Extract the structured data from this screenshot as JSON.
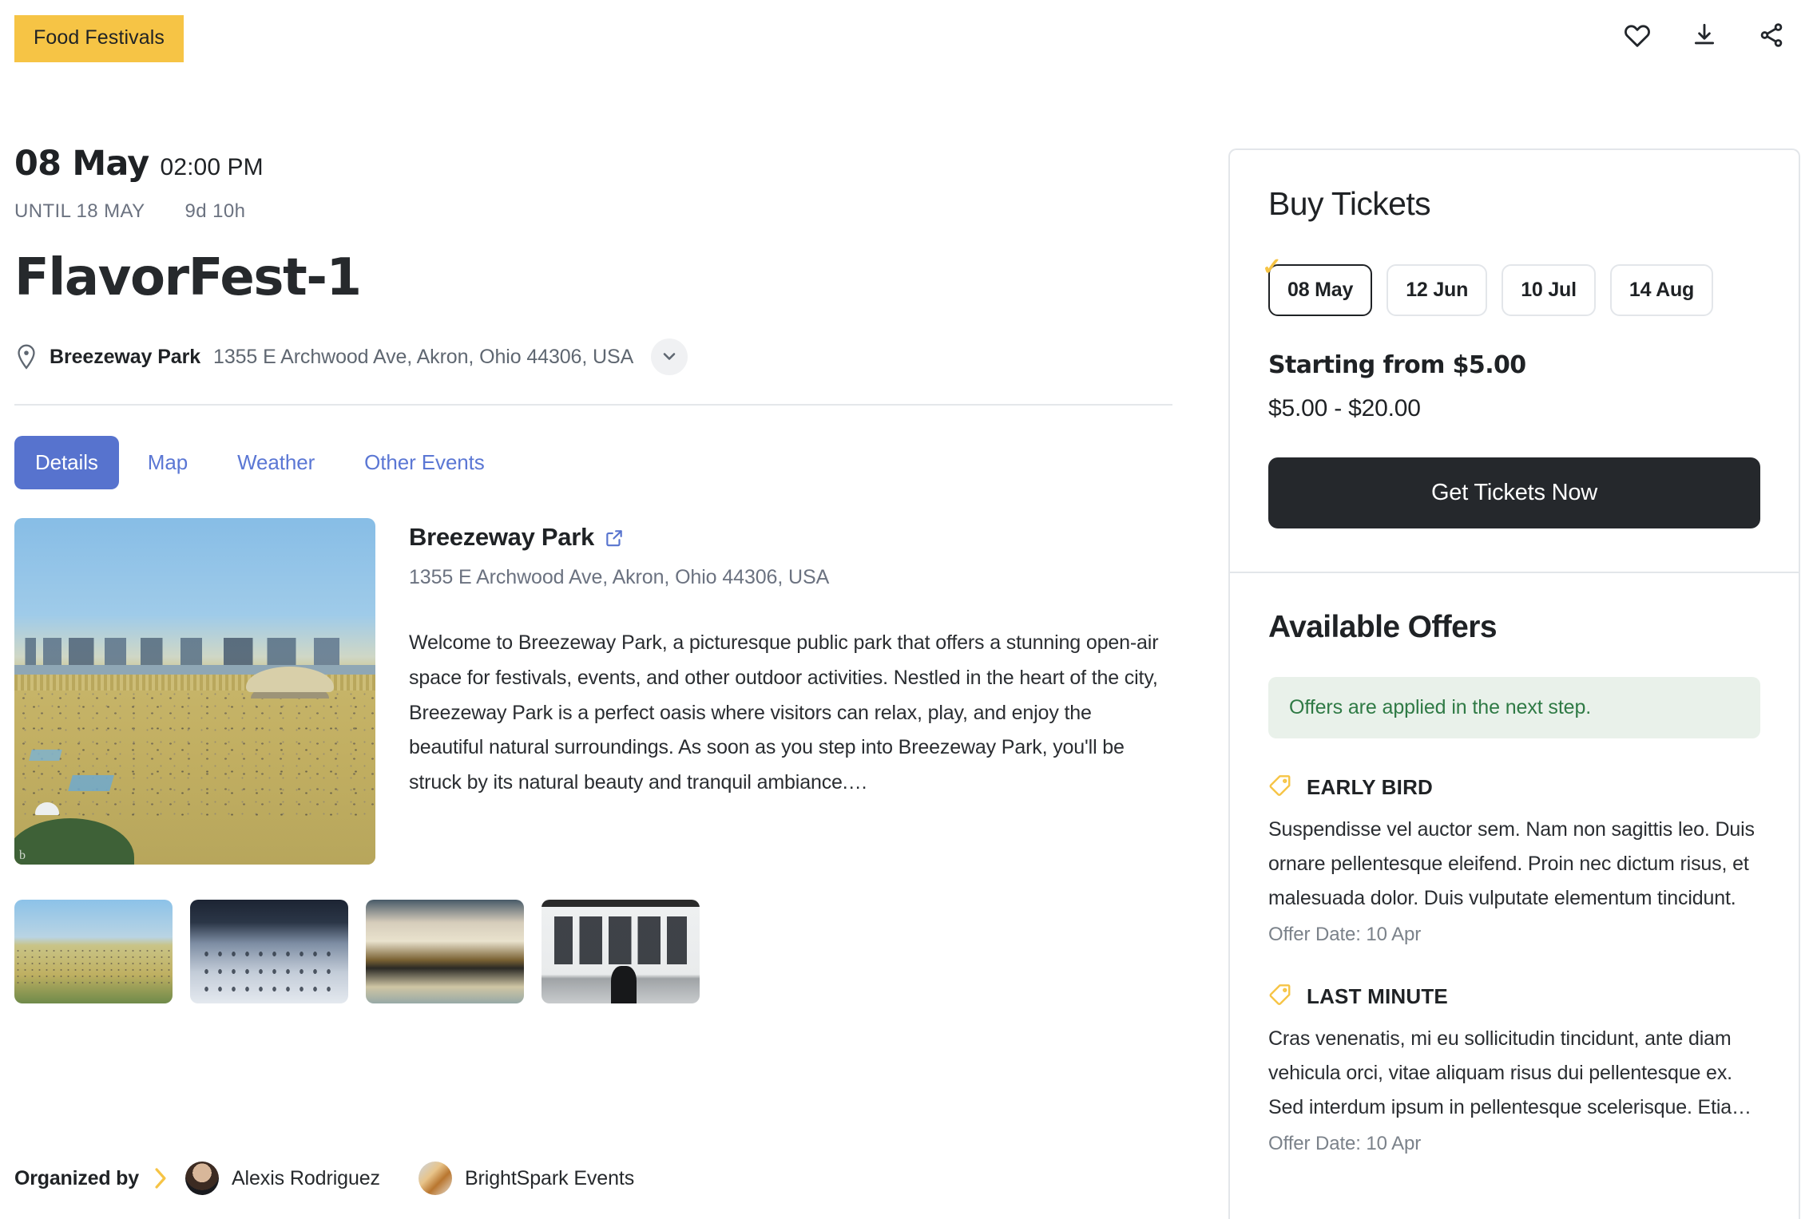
{
  "topbar": {
    "category_badge": "Food Festivals",
    "actions": [
      {
        "name": "favorite-button",
        "icon": "heart-icon"
      },
      {
        "name": "download-button",
        "icon": "download-icon"
      },
      {
        "name": "share-button",
        "icon": "share-icon"
      }
    ]
  },
  "event": {
    "date": "08 May",
    "time": "02:00 PM",
    "until": "UNTIL 18 MAY",
    "duration": "9d 10h",
    "title": "FlavorFest-1",
    "venue_name": "Breezeway Park",
    "venue_address": "1355 E Archwood Ave, Akron, Ohio 44306, USA"
  },
  "tabs": [
    {
      "label": "Details",
      "active": true
    },
    {
      "label": "Map",
      "active": false
    },
    {
      "label": "Weather",
      "active": false
    },
    {
      "label": "Other Events",
      "active": false
    }
  ],
  "details": {
    "venue_title": "Breezeway Park",
    "venue_address": "1355 E Archwood Ave, Akron, Ohio 44306, USA",
    "description": "Welcome to Breezeway Park, a picturesque public park that offers a stunning open-air space for festivals, events, and other outdoor activities. Nestled in the heart of the city, Breezeway Park is a perfect oasis where visitors can relax, play, and enjoy the beautiful natural surroundings. As soon as you step into Breezeway Park, you'll be struck by its natural beauty and tranquil ambiance.…",
    "hero_watermark": "b",
    "thumbnails": [
      {
        "alt": "park-aerial-thumbnail"
      },
      {
        "alt": "convention-hall-thumbnail"
      },
      {
        "alt": "painting-capitol-thumbnail"
      },
      {
        "alt": "gallery-visitor-thumbnail"
      }
    ]
  },
  "organizer": {
    "label": "Organized by",
    "people": [
      {
        "name": "Alexis Rodriguez"
      },
      {
        "name": "BrightSpark Events"
      }
    ]
  },
  "sidebar": {
    "buy": {
      "title": "Buy Tickets",
      "dates": [
        {
          "label": "08 May",
          "selected": true
        },
        {
          "label": "12 Jun",
          "selected": false
        },
        {
          "label": "10 Jul",
          "selected": false
        },
        {
          "label": "14 Aug",
          "selected": false
        }
      ],
      "starting_from": "Starting from $5.00",
      "price_range": "$5.00 - $20.00",
      "cta_label": "Get Tickets Now"
    },
    "offers": {
      "title": "Available Offers",
      "note": "Offers are applied in the next step.",
      "items": [
        {
          "name": "EARLY BIRD",
          "description": "Suspendisse vel auctor sem. Nam non sagittis leo. Duis ornare pellentesque eleifend. Proin nec dictum risus, et malesuada dolor. Duis vulputate elementum tincidunt.",
          "date": "Offer Date: 10 Apr"
        },
        {
          "name": "LAST MINUTE",
          "description": "Cras venenatis, mi eu sollicitudin tincidunt, ante diam vehicula orci, vitae aliquam risus dui pellentesque ex. Sed interdum ipsum in pellentesque scelerisque. Etia…",
          "date": "Offer Date: 10 Apr"
        }
      ]
    }
  },
  "colors": {
    "badge_yellow": "#f6c445",
    "tab_active_blue": "#5773ce",
    "cta_dark": "#25282c",
    "offer_note_green": "#2f7a45",
    "muted_gray": "#6b7280"
  }
}
